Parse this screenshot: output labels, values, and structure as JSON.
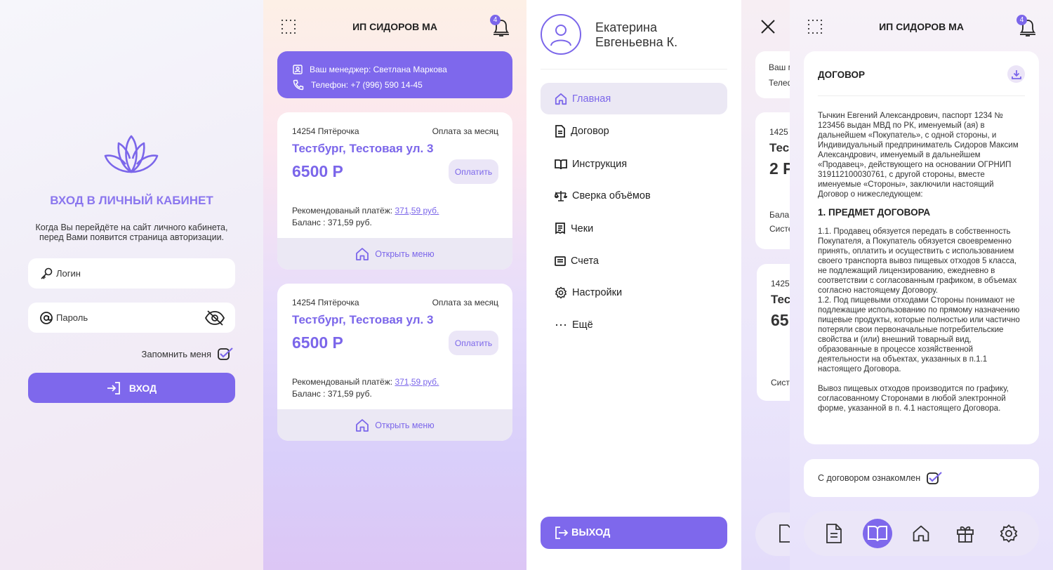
{
  "colors": {
    "accent": "#7e68ec",
    "accent_text": "#7b66ea",
    "soft": "#ebe8f4"
  },
  "login": {
    "title": "ВХОД В ЛИЧНЫЙ КАБИНЕТ",
    "hint": "Когда Вы перейдёте на сайт личного кабинета, перед Вами появится страница авторизации.",
    "login_placeholder": "Логин",
    "password_placeholder": "Пароль",
    "remember": "Запомнить меня",
    "button": "ВХОД"
  },
  "header": {
    "title": "ИП СИДОРОВ МА",
    "notifications": "4"
  },
  "manager": {
    "name": "Ваш менеджер: Светлана Маркова",
    "phone": "Телефон: +7 (996) 590 14-45"
  },
  "cards": [
    {
      "id": "14254 Пятёрочка",
      "period": "Оплата за месяц",
      "address": "Тестбург, Тестовая ул. 3",
      "amount": "6500 Р",
      "pay": "Оплатить",
      "rec_label": "Рекомендованый платёж:",
      "rec_value": "371,59 руб.",
      "balance": "Баланс : 371,59 руб.",
      "menu": "Открыть меню"
    },
    {
      "id": "14254 Пятёрочка",
      "period": "Оплата за месяц",
      "address": "Тестбург, Тестовая ул. 3",
      "amount": "6500 Р",
      "pay": "Оплатить",
      "rec_label": "Рекомендованый платёж:",
      "rec_value": "371,59 руб.",
      "balance": "Баланс : 371,59 руб.",
      "menu": "Открыть меню"
    }
  ],
  "drawer": {
    "user_first": "Екатерина",
    "user_last": "Евгеньевна К.",
    "items": [
      {
        "label": "Главная",
        "icon": "home-icon"
      },
      {
        "label": "Договор",
        "icon": "document-icon"
      },
      {
        "label": "Инструкция",
        "icon": "book-icon"
      },
      {
        "label": "Сверка объёмов",
        "icon": "scales-icon"
      },
      {
        "label": "Чеки",
        "icon": "receipt-icon"
      },
      {
        "label": "Счета",
        "icon": "invoice-icon"
      },
      {
        "label": "Настройки",
        "icon": "gear-icon"
      },
      {
        "label": "Ещё",
        "icon": "more-icon"
      }
    ],
    "logout": "ВЫХОД"
  },
  "peek": {
    "mgr": "Ваш м",
    "tel": "Телеф",
    "id1": "1425",
    "t1": "Тес",
    "a1": "2 Р",
    "bal": "Бала",
    "sys": "Систе",
    "id2": "1425",
    "t2": "Тес",
    "a2": "65",
    "sys2": "Сист"
  },
  "contract": {
    "title": "ДОГОВОР",
    "intro": "Тычкин Евгений Александрович, паспорт 1234 № 123456 выдан МВД по РК, именуемый (ая) в дальнейшем «Покупатель», с одной стороны, и Индивидуальный предприниматель Сидоров Максим Александрович, именуемый в дальнейшем «Продавец», действующего на основании ОГРНИП 319112100030761, с другой стороны, вместе именуемые «Стороны», заключили настоящий Договор о нижеследующем:",
    "section1": "1. ПРЕДМЕТ ДОГОВОРА",
    "p11": "1.1. Продавец обязуется передать в собственность Покупателя, а Покупатель обязуется своевременно принять, оплатить и осуществить с использованием своего транспорта вывоз пищевых отходов 5 класса, не подлежащий лицензированию, ежедневно в соответствии с согласованным графиком, в объемах согласно настоящему Договору.",
    "p12": "1.2. Под пищевыми отходами Стороны понимают не подлежащие использованию по прямому назначению пищевые продукты, которые полностью или частично потеряли свои первоначальные потребительские свойства и (или) внешний товарный вид, образованные в процессе хозяйственной деятельности на объектах, указанных в п.1.1 настоящего Договора.",
    "p13": "Вывоз пищевых отходов производится по графику, согласованному Сторонами в любой электронной форме, указанной в п. 4.1 настоящего Договора.",
    "agree": "С договором ознакомлен"
  },
  "tabbar": [
    "document-icon",
    "book-icon",
    "home-icon",
    "gift-icon",
    "gear-icon"
  ]
}
